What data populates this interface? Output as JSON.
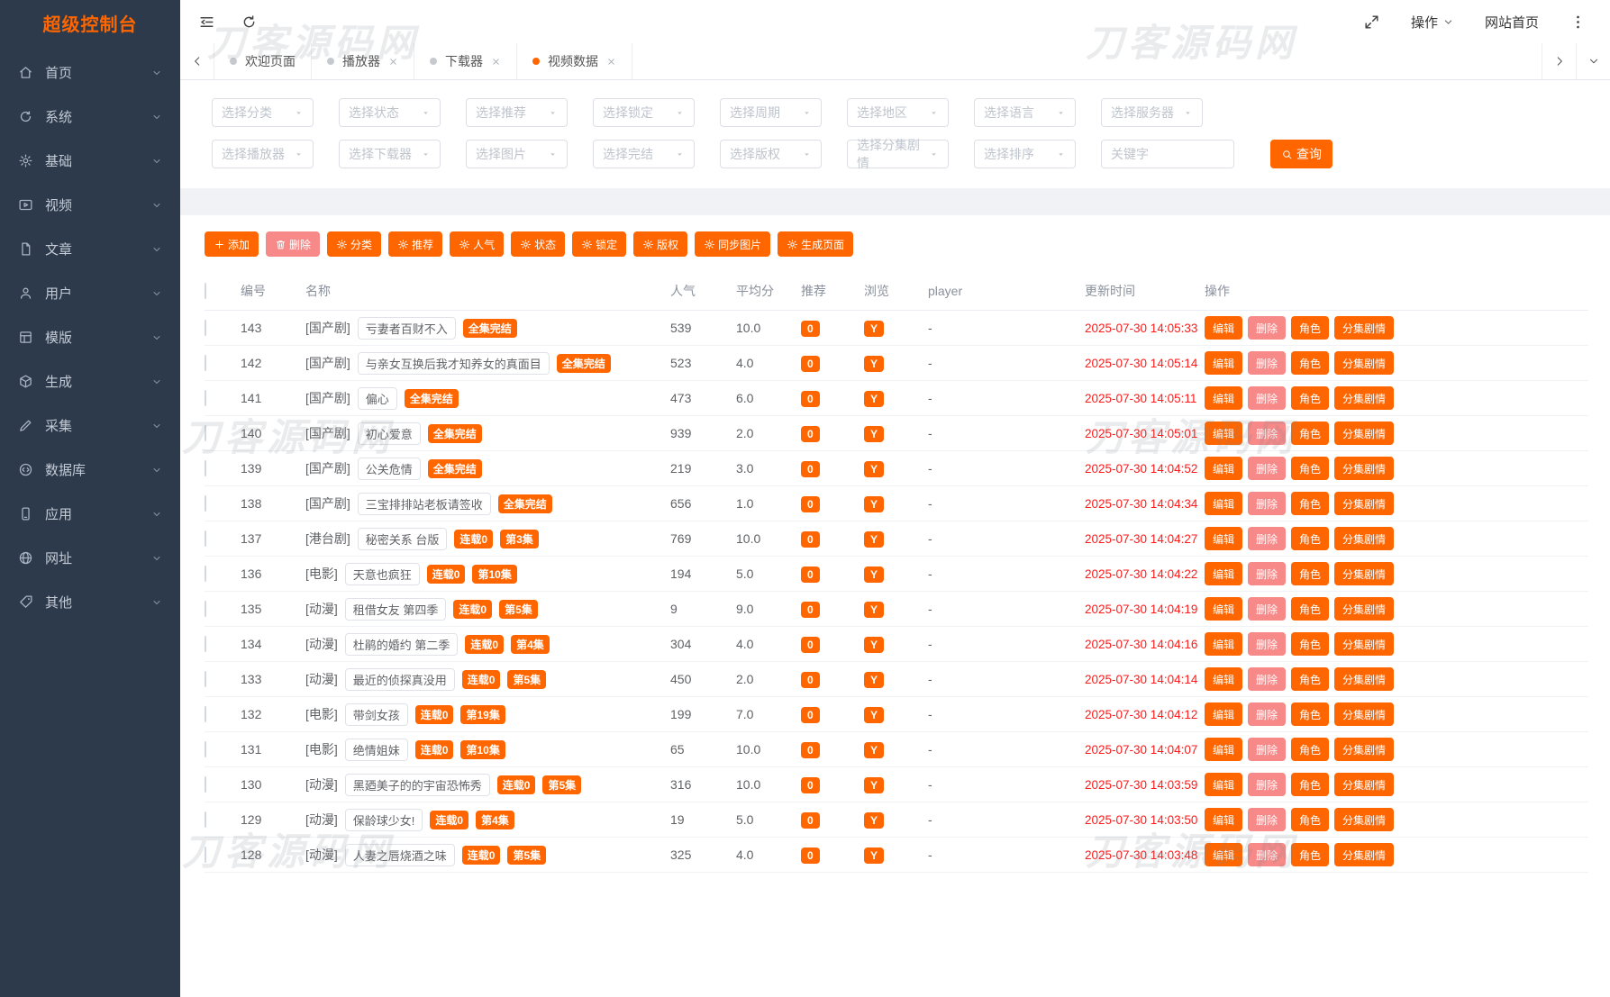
{
  "app": {
    "title": "超级控制台"
  },
  "colors": {
    "primary": "#ff6600",
    "delete_pink": "#f78989",
    "timestamp_red": "#ff1a1a",
    "sidebar_bg": "#2d3a4b"
  },
  "watermark": {
    "text": "刀客源码网"
  },
  "sidebar": {
    "items": [
      {
        "key": "home",
        "icon": "home-icon",
        "label": "首页"
      },
      {
        "key": "system",
        "icon": "system-icon",
        "label": "系统"
      },
      {
        "key": "base",
        "icon": "gear-icon",
        "label": "基础"
      },
      {
        "key": "video",
        "icon": "video-icon",
        "label": "视频"
      },
      {
        "key": "article",
        "icon": "article-icon",
        "label": "文章"
      },
      {
        "key": "user",
        "icon": "user-icon",
        "label": "用户"
      },
      {
        "key": "template",
        "icon": "template-icon",
        "label": "模版"
      },
      {
        "key": "generate",
        "icon": "cube-icon",
        "label": "生成"
      },
      {
        "key": "collect",
        "icon": "pen-icon",
        "label": "采集"
      },
      {
        "key": "database",
        "icon": "database-icon",
        "label": "数据库"
      },
      {
        "key": "app",
        "icon": "app-icon",
        "label": "应用"
      },
      {
        "key": "site",
        "icon": "globe-icon",
        "label": "网址"
      },
      {
        "key": "other",
        "icon": "tag-icon",
        "label": "其他"
      }
    ]
  },
  "topbar": {
    "actions_label": "操作",
    "site_home_label": "网站首页"
  },
  "tabs": [
    {
      "key": "welcome",
      "label": "欢迎页面",
      "closable": false,
      "active": false
    },
    {
      "key": "player",
      "label": "播放器",
      "closable": true,
      "active": false
    },
    {
      "key": "downloader",
      "label": "下载器",
      "closable": true,
      "active": false
    },
    {
      "key": "video-data",
      "label": "视频数据",
      "closable": true,
      "active": true
    }
  ],
  "filters": {
    "row1": [
      "选择分类",
      "选择状态",
      "选择推荐",
      "选择锁定",
      "选择周期",
      "选择地区",
      "选择语言",
      "选择服务器"
    ],
    "row2": [
      "选择播放器",
      "选择下载器",
      "选择图片",
      "选择完结",
      "选择版权",
      "选择分集剧情",
      "选择排序"
    ],
    "keyword_placeholder": "关键字",
    "search_label": "查询"
  },
  "toolbar": {
    "buttons": [
      {
        "key": "add",
        "label": "添加",
        "icon": "plus-icon",
        "variant": "orange"
      },
      {
        "key": "delete",
        "label": "删除",
        "icon": "trash-icon",
        "variant": "pink"
      },
      {
        "key": "category",
        "label": "分类",
        "icon": "gear-icon",
        "variant": "orange"
      },
      {
        "key": "recommend",
        "label": "推荐",
        "icon": "gear-icon",
        "variant": "orange"
      },
      {
        "key": "popularity",
        "label": "人气",
        "icon": "gear-icon",
        "variant": "orange"
      },
      {
        "key": "status",
        "label": "状态",
        "icon": "gear-icon",
        "variant": "orange"
      },
      {
        "key": "lock",
        "label": "锁定",
        "icon": "gear-icon",
        "variant": "orange"
      },
      {
        "key": "copyright",
        "label": "版权",
        "icon": "gear-icon",
        "variant": "orange"
      },
      {
        "key": "sync-images",
        "label": "同步图片",
        "icon": "gear-icon",
        "variant": "orange"
      },
      {
        "key": "generate-pages",
        "label": "生成页面",
        "icon": "gear-icon",
        "variant": "orange"
      }
    ]
  },
  "table": {
    "columns": [
      "编号",
      "名称",
      "人气",
      "平均分",
      "推荐",
      "浏览",
      "player",
      "更新时间",
      "操作"
    ],
    "row_actions": [
      {
        "key": "edit",
        "label": "编辑",
        "variant": "orange"
      },
      {
        "key": "delete",
        "label": "删除",
        "variant": "pink"
      },
      {
        "key": "role",
        "label": "角色",
        "variant": "orange"
      },
      {
        "key": "episodes",
        "label": "分集剧情",
        "variant": "orange"
      }
    ],
    "rows": [
      {
        "id": "143",
        "category": "[国产剧]",
        "title": "亏妻者百财不入",
        "tags": [
          "全集完结"
        ],
        "popularity": "539",
        "avg_score": "10.0",
        "recommend": "0",
        "views": "Y",
        "player": "-",
        "updated": "2025-07-30 14:05:33"
      },
      {
        "id": "142",
        "category": "[国产剧]",
        "title": "与亲女互换后我才知养女的真面目",
        "tags": [
          "全集完结"
        ],
        "popularity": "523",
        "avg_score": "4.0",
        "recommend": "0",
        "views": "Y",
        "player": "-",
        "updated": "2025-07-30 14:05:14"
      },
      {
        "id": "141",
        "category": "[国产剧]",
        "title": "偏心",
        "tags": [
          "全集完结"
        ],
        "popularity": "473",
        "avg_score": "6.0",
        "recommend": "0",
        "views": "Y",
        "player": "-",
        "updated": "2025-07-30 14:05:11"
      },
      {
        "id": "140",
        "category": "[国产剧]",
        "title": "初心爱意",
        "tags": [
          "全集完结"
        ],
        "popularity": "939",
        "avg_score": "2.0",
        "recommend": "0",
        "views": "Y",
        "player": "-",
        "updated": "2025-07-30 14:05:01"
      },
      {
        "id": "139",
        "category": "[国产剧]",
        "title": "公关危情",
        "tags": [
          "全集完结"
        ],
        "popularity": "219",
        "avg_score": "3.0",
        "recommend": "0",
        "views": "Y",
        "player": "-",
        "updated": "2025-07-30 14:04:52"
      },
      {
        "id": "138",
        "category": "[国产剧]",
        "title": "三宝排排站老板请签收",
        "tags": [
          "全集完结"
        ],
        "popularity": "656",
        "avg_score": "1.0",
        "recommend": "0",
        "views": "Y",
        "player": "-",
        "updated": "2025-07-30 14:04:34"
      },
      {
        "id": "137",
        "category": "[港台剧]",
        "title": "秘密关系 台版",
        "tags": [
          "连载0",
          "第3集"
        ],
        "popularity": "769",
        "avg_score": "10.0",
        "recommend": "0",
        "views": "Y",
        "player": "-",
        "updated": "2025-07-30 14:04:27"
      },
      {
        "id": "136",
        "category": "[电影]",
        "title": "天意也疯狂",
        "tags": [
          "连载0",
          "第10集"
        ],
        "popularity": "194",
        "avg_score": "5.0",
        "recommend": "0",
        "views": "Y",
        "player": "-",
        "updated": "2025-07-30 14:04:22"
      },
      {
        "id": "135",
        "category": "[动漫]",
        "title": "租借女友 第四季",
        "tags": [
          "连载0",
          "第5集"
        ],
        "popularity": "9",
        "avg_score": "9.0",
        "recommend": "0",
        "views": "Y",
        "player": "-",
        "updated": "2025-07-30 14:04:19"
      },
      {
        "id": "134",
        "category": "[动漫]",
        "title": "杜鹃的婚约 第二季",
        "tags": [
          "连载0",
          "第4集"
        ],
        "popularity": "304",
        "avg_score": "4.0",
        "recommend": "0",
        "views": "Y",
        "player": "-",
        "updated": "2025-07-30 14:04:16"
      },
      {
        "id": "133",
        "category": "[动漫]",
        "title": "最近的侦探真没用",
        "tags": [
          "连载0",
          "第5集"
        ],
        "popularity": "450",
        "avg_score": "2.0",
        "recommend": "0",
        "views": "Y",
        "player": "-",
        "updated": "2025-07-30 14:04:14"
      },
      {
        "id": "132",
        "category": "[电影]",
        "title": "带剑女孩",
        "tags": [
          "连载0",
          "第19集"
        ],
        "popularity": "199",
        "avg_score": "7.0",
        "recommend": "0",
        "views": "Y",
        "player": "-",
        "updated": "2025-07-30 14:04:12"
      },
      {
        "id": "131",
        "category": "[电影]",
        "title": "绝情姐妹",
        "tags": [
          "连载0",
          "第10集"
        ],
        "popularity": "65",
        "avg_score": "10.0",
        "recommend": "0",
        "views": "Y",
        "player": "-",
        "updated": "2025-07-30 14:04:07"
      },
      {
        "id": "130",
        "category": "[动漫]",
        "title": "黑廼美子的的宇宙恐怖秀",
        "tags": [
          "连载0",
          "第5集"
        ],
        "popularity": "316",
        "avg_score": "10.0",
        "recommend": "0",
        "views": "Y",
        "player": "-",
        "updated": "2025-07-30 14:03:59"
      },
      {
        "id": "129",
        "category": "[动漫]",
        "title": "保龄球少女!",
        "tags": [
          "连载0",
          "第4集"
        ],
        "popularity": "19",
        "avg_score": "5.0",
        "recommend": "0",
        "views": "Y",
        "player": "-",
        "updated": "2025-07-30 14:03:50"
      },
      {
        "id": "128",
        "category": "[动漫]",
        "title": "人妻之唇烧酒之味",
        "tags": [
          "连载0",
          "第5集"
        ],
        "popularity": "325",
        "avg_score": "4.0",
        "recommend": "0",
        "views": "Y",
        "player": "-",
        "updated": "2025-07-30 14:03:48"
      }
    ]
  }
}
